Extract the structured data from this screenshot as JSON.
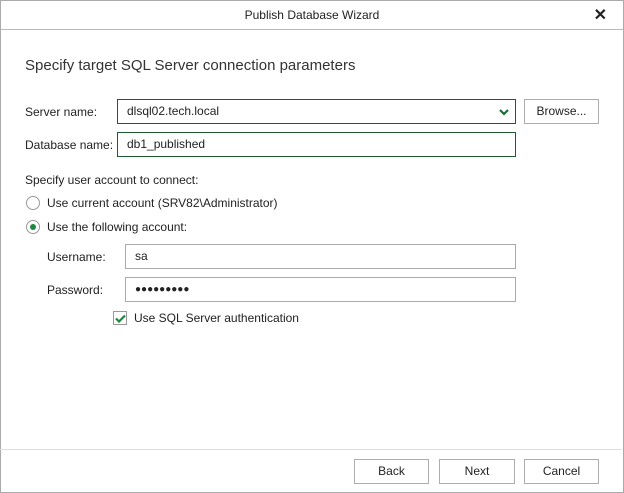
{
  "window": {
    "title": "Publish Database Wizard"
  },
  "heading": "Specify target SQL Server connection parameters",
  "server": {
    "label": "Server name:",
    "value": "dlsql02.tech.local",
    "browse_label": "Browse..."
  },
  "database": {
    "label": "Database name:",
    "value": "db1_published"
  },
  "account": {
    "label": "Specify user account to connect:",
    "options": [
      {
        "label": "Use current account (SRV82\\Administrator)",
        "selected": false
      },
      {
        "label": "Use the following account:",
        "selected": true
      }
    ],
    "username": {
      "label": "Username:",
      "value": "sa"
    },
    "password": {
      "label": "Password:",
      "value": "●●●●●●●●●"
    },
    "sql_auth": {
      "label": "Use SQL Server authentication",
      "checked": true
    }
  },
  "footer": {
    "back": "Back",
    "next": "Next",
    "cancel": "Cancel"
  },
  "colors": {
    "accent": "#1c8a3c",
    "active_border": "#1e5b2f"
  }
}
